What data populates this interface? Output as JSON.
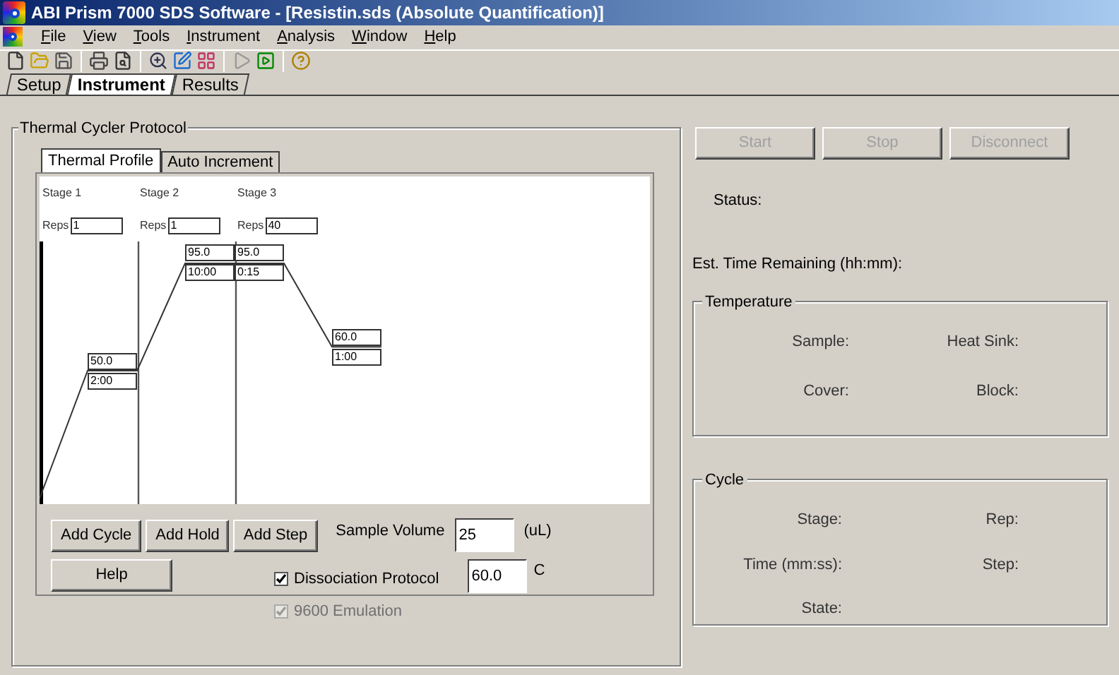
{
  "window": {
    "title": "ABI Prism 7000 SDS Software - [Resistin.sds (Absolute Quantification)]"
  },
  "menu": [
    "File",
    "View",
    "Tools",
    "Instrument",
    "Analysis",
    "Window",
    "Help"
  ],
  "tabs": [
    {
      "label": "Setup",
      "selected": false
    },
    {
      "label": "Instrument",
      "selected": true
    },
    {
      "label": "Results",
      "selected": false
    }
  ],
  "protocol": {
    "title": "Thermal Cycler Protocol",
    "tabs": [
      {
        "label": "Thermal Profile",
        "selected": true
      },
      {
        "label": "Auto Increment",
        "selected": false
      }
    ],
    "stages": [
      {
        "label": "Stage 1",
        "reps_label": "Reps",
        "reps": "1",
        "steps": [
          {
            "temp": "50.0",
            "time": "2:00"
          }
        ]
      },
      {
        "label": "Stage 2",
        "reps_label": "Reps",
        "reps": "1",
        "steps": [
          {
            "temp": "95.0",
            "time": "10:00"
          }
        ]
      },
      {
        "label": "Stage 3",
        "reps_label": "Reps",
        "reps": "40",
        "steps": [
          {
            "temp": "95.0",
            "time": "0:15"
          },
          {
            "temp": "60.0",
            "time": "1:00"
          }
        ]
      }
    ],
    "buttons": [
      "Add Cycle",
      "Add Hold",
      "Add Step",
      "Help"
    ],
    "sample_volume": {
      "label": "Sample Volume",
      "value": "25",
      "unit": "(uL)"
    },
    "dissociation": {
      "label": "Dissociation Protocol",
      "checked": true,
      "disabled": false,
      "value": "60.0",
      "unit": "C"
    },
    "emulation": {
      "label": "9600 Emulation",
      "checked": true,
      "disabled": true
    }
  },
  "run_buttons": [
    {
      "label": "Start",
      "disabled": true
    },
    {
      "label": "Stop",
      "disabled": true
    },
    {
      "label": "Disconnect",
      "disabled": true
    }
  ],
  "status_label": "Status:",
  "time_remaining_label": "Est. Time Remaining (hh:mm):",
  "temperature": {
    "title": "Temperature",
    "fields": [
      "Sample:",
      "Heat Sink:",
      "Cover:",
      "Block:"
    ]
  },
  "cycle": {
    "title": "Cycle",
    "fields": [
      "Stage:",
      "Rep:",
      "Time (mm:ss):",
      "Step:",
      "State:"
    ]
  }
}
